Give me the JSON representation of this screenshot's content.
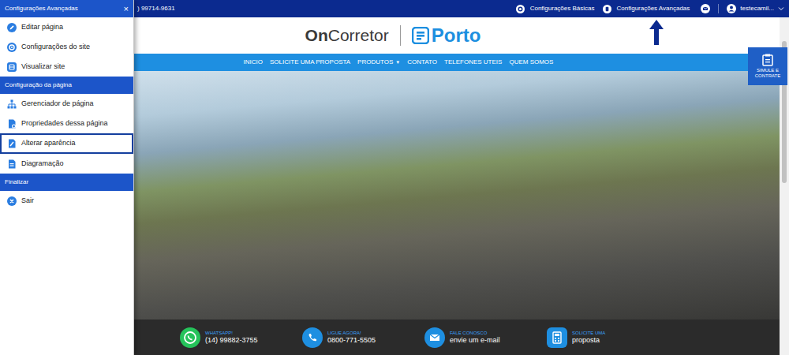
{
  "topbar": {
    "phone": ") 99714-9631",
    "links": [
      {
        "label": "Configurações Básicas"
      },
      {
        "label": "Configurações Avançadas"
      }
    ],
    "user": "testecamil..."
  },
  "sidebar": {
    "title": "Configurações Avançadas",
    "close": "×",
    "items": [
      {
        "label": "Editar página",
        "kind": "item",
        "selected": false
      },
      {
        "label": "Configurações do site",
        "kind": "item",
        "selected": false
      },
      {
        "label": "Visualizar site",
        "kind": "item",
        "selected": false
      },
      {
        "label": "Configuração da página",
        "kind": "header",
        "selected": false
      },
      {
        "label": "Gerenciador de página",
        "kind": "item",
        "selected": false
      },
      {
        "label": "Propriedades dessa página",
        "kind": "item",
        "selected": false
      },
      {
        "label": "Alterar aparência",
        "kind": "item",
        "selected": true
      },
      {
        "label": "Diagramação",
        "kind": "item",
        "selected": false
      },
      {
        "label": "Finalizar",
        "kind": "header",
        "selected": false
      },
      {
        "label": "Sair",
        "kind": "item",
        "selected": false
      }
    ]
  },
  "logo": {
    "bold": "On",
    "rest": "Corretor",
    "partner": "Porto"
  },
  "nav": [
    {
      "label": "INICIO"
    },
    {
      "label": "SOLICITE UMA PROPOSTA"
    },
    {
      "label": "PRODUTOS",
      "caret": "▼"
    },
    {
      "label": "CONTATO"
    },
    {
      "label": "TELEFONES UTEIS"
    },
    {
      "label": "QUEM SOMOS"
    }
  ],
  "simulate": "SIMULE E CONTRATE",
  "contacts": [
    {
      "label": "WHATSAPP!",
      "value": "(14) 99882-3755",
      "kind": "whatsapp"
    },
    {
      "label": "LIGUE AGORA!",
      "value": "0800-771-5505",
      "kind": "phone"
    },
    {
      "label": "FALE CONOSCO",
      "value": "envie um e-mail",
      "kind": "email"
    },
    {
      "label": "SOLICITE UMA",
      "value": "proposta",
      "kind": "form"
    }
  ]
}
